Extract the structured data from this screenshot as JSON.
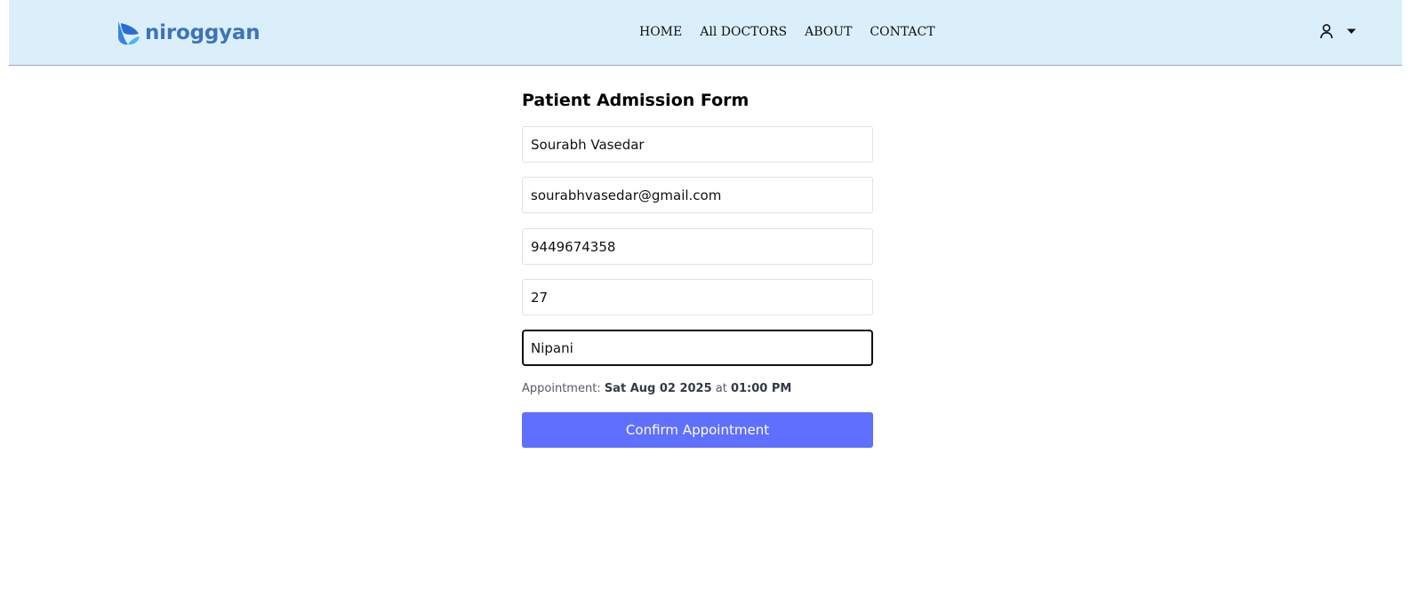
{
  "brand": {
    "name": "niroggyan",
    "logo_icon": "leaf-logo-icon",
    "color": "#3d74b8"
  },
  "nav": {
    "items": [
      {
        "label": "HOME"
      },
      {
        "label": "All DOCTORS"
      },
      {
        "label": "ABOUT"
      },
      {
        "label": "CONTACT"
      }
    ]
  },
  "user_menu": {
    "icon": "user-icon",
    "dropdown_icon": "caret-down-icon"
  },
  "form": {
    "title": "Patient Admission Form",
    "fields": [
      {
        "name": "full-name",
        "value": "Sourabh Vasedar"
      },
      {
        "name": "email",
        "value": "sourabhvasedar@gmail.com"
      },
      {
        "name": "phone",
        "value": "9449674358"
      },
      {
        "name": "age",
        "value": "27"
      },
      {
        "name": "address",
        "value": "Nipani",
        "focused": true
      }
    ],
    "appointment": {
      "label": "Appointment: ",
      "date": "Sat Aug 02 2025",
      "connector": " at ",
      "time": "01:00 PM"
    },
    "submit_label": "Confirm Appointment"
  },
  "colors": {
    "navbar_bg": "#dbeffb",
    "accent": "#5f6ffe",
    "focus_border": "#111111"
  }
}
